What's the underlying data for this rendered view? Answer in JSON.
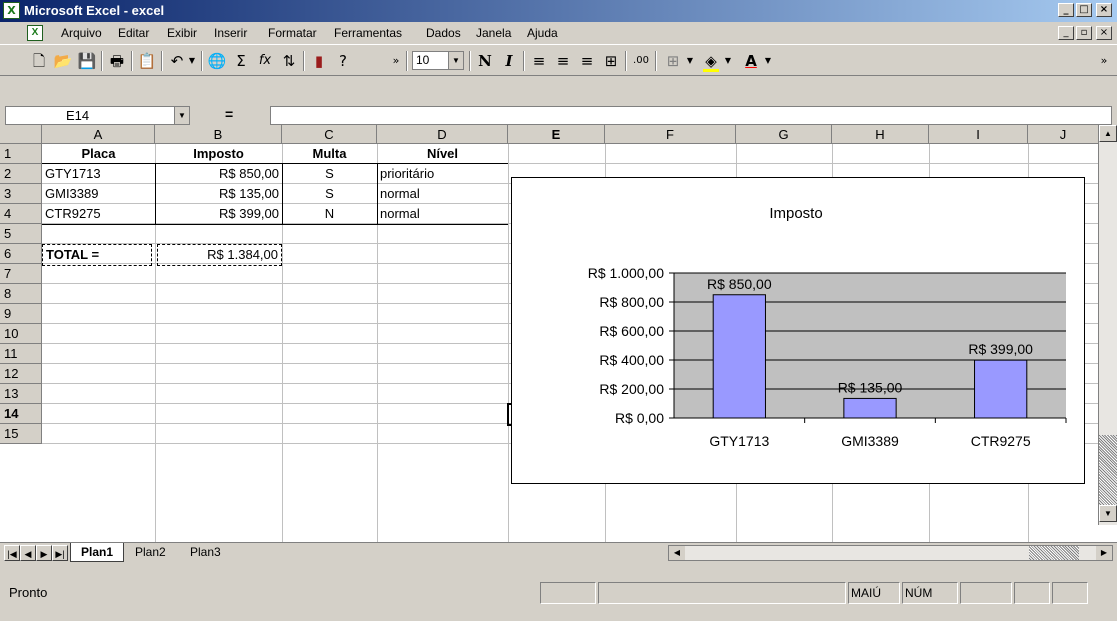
{
  "window": {
    "title": "Microsoft Excel - excel"
  },
  "menu": [
    "Arquivo",
    "Editar",
    "Exibir",
    "Inserir",
    "Formatar",
    "Ferramentas",
    "Dados",
    "Janela",
    "Ajuda"
  ],
  "toolbar": {
    "font_size": "10",
    "bold": "N",
    "italic": "I"
  },
  "formula_bar": {
    "name_box": "E14",
    "equals": "=",
    "value": ""
  },
  "columns": [
    "A",
    "B",
    "C",
    "D",
    "E",
    "F",
    "G",
    "H",
    "I",
    "J"
  ],
  "active_cell": "E14",
  "rows": [
    "1",
    "2",
    "3",
    "4",
    "5",
    "6",
    "7",
    "8",
    "9",
    "10",
    "11",
    "12",
    "13",
    "14",
    "15"
  ],
  "table": {
    "headers": [
      "Placa",
      "Imposto",
      "Multa",
      "Nível"
    ],
    "records": [
      [
        "GTY1713",
        "R$ 850,00",
        "S",
        "prioritário"
      ],
      [
        "GMI3389",
        "R$ 135,00",
        "S",
        "normal"
      ],
      [
        "CTR9275",
        "R$ 399,00",
        "N",
        "normal"
      ]
    ],
    "total_label": "TOTAL =",
    "total_value": "R$ 1.384,00"
  },
  "chart_data": {
    "type": "bar",
    "title": "Imposto",
    "categories": [
      "GTY1713",
      "GMI3389",
      "CTR9275"
    ],
    "values": [
      850,
      135,
      399
    ],
    "data_labels": [
      "R$ 850,00",
      "R$ 135,00",
      "R$ 399,00"
    ],
    "yticks": [
      "R$ 0,00",
      "R$ 200,00",
      "R$ 400,00",
      "R$ 600,00",
      "R$ 800,00",
      "R$ 1.000,00"
    ],
    "ylim": [
      0,
      1000
    ],
    "grid": true,
    "bar_color": "#9999ff",
    "plot_background": "#c0c0c0"
  },
  "sheets": [
    "Plan1",
    "Plan2",
    "Plan3"
  ],
  "active_sheet": "Plan1",
  "status": {
    "text": "Pronto",
    "caps": "MAIÚ",
    "num": "NÚM"
  }
}
